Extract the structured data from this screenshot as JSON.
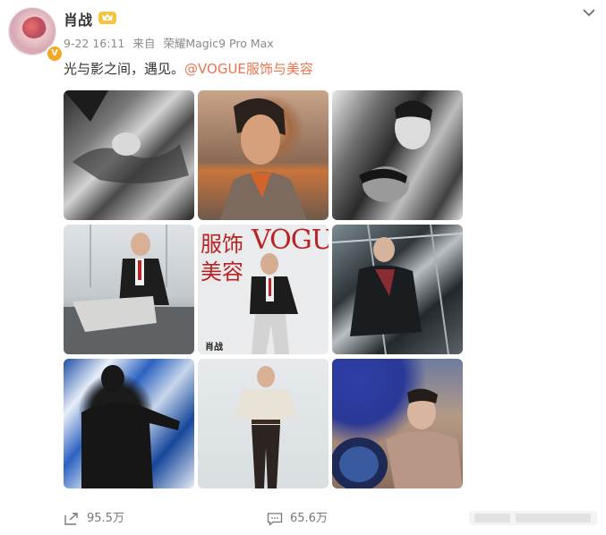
{
  "user": {
    "name": "肖战",
    "time": "9-22 16:11",
    "source_prefix": "来自",
    "source_device": "荣耀Magic9 Pro Max"
  },
  "post": {
    "text": "光与影之间，遇见。",
    "mention": "@VOGUE服饰与美容"
  },
  "cover": {
    "title_en": "VOGUE",
    "title_cn_line1": "服饰",
    "title_cn_line2": "美容",
    "name": "肖战"
  },
  "actions": {
    "repost_count": "95.5万",
    "comment_count": "65.6万"
  },
  "colors": {
    "mention": "#eb7350",
    "verified": "#f5a623",
    "vogue_red": "#b82424"
  }
}
